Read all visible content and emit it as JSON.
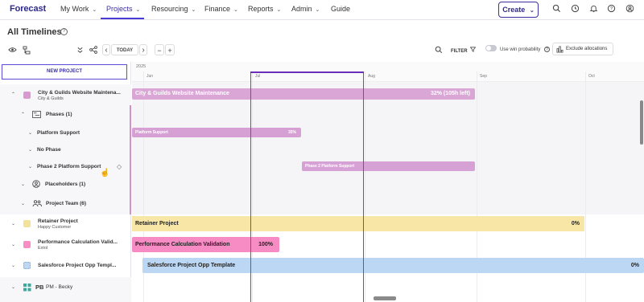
{
  "nav": {
    "logo": "Forecast",
    "items": [
      {
        "label": "My Work",
        "chev": "⌄"
      },
      {
        "label": "Projects",
        "chev": "⌄"
      },
      {
        "label": "Resourcing",
        "chev": "⌄"
      },
      {
        "label": "Finance",
        "chev": "⌄"
      },
      {
        "label": "Reports",
        "chev": "⌄"
      },
      {
        "label": "Admin",
        "chev": "⌄"
      },
      {
        "label": "Guide",
        "chev": ""
      }
    ],
    "create_label": "Create",
    "create_chev": "⌄",
    "icons": [
      "search-icon",
      "clock-icon",
      "bell-icon",
      "help-icon",
      "user-icon"
    ]
  },
  "page": {
    "title": "All Timelines",
    "help": "?"
  },
  "toolbar": {
    "today": "TODAY",
    "prev": "‹",
    "next": "›",
    "minus": "−",
    "plus": "+",
    "filter": "FILTER",
    "win_probability": "Use win probability",
    "exclude_allocations": "Exclude allocations"
  },
  "left": {
    "new_project": "NEW PROJECT",
    "rows": [
      {
        "title": "City & Guilds Website Maintena...",
        "sub": "City & Guilds",
        "color": "#d89ad0"
      },
      {
        "title": "Phases (1)"
      },
      {
        "title": "Platform Support"
      },
      {
        "title": "No Phase"
      },
      {
        "title": "Phase 2 Platform Support"
      },
      {
        "title": "Placeholders (1)"
      },
      {
        "title": "Project Team (6)"
      },
      {
        "title": "Retainer Project",
        "sub": "Happy Customer",
        "color": "#f4e29a"
      },
      {
        "title": "Performance Calculation Valid...",
        "sub": "Extol",
        "color": "#f78dc4"
      },
      {
        "title": "Salesforce Project Opp Templ...",
        "color": "#bcd8f2"
      },
      {
        "title": "PM - Becky",
        "prefix": "PB"
      }
    ]
  },
  "timeline": {
    "year": "2025",
    "months": [
      "Jun",
      "Jul",
      "Aug",
      "Sep",
      "Oct"
    ],
    "bars": [
      {
        "label": "City & Guilds Website Maintenance",
        "right": "32%  (105h left)",
        "color": "#d9a6d6"
      },
      {
        "label": "Platform Support",
        "right": "35%",
        "color": "#d7a0d5"
      },
      {
        "label": "Phase 2 Platform Support",
        "right": "",
        "color": "#d6a2d5"
      },
      {
        "label": "Retainer Project",
        "right": "0%",
        "color": "#f7e6a6"
      },
      {
        "label": "Performance Calculation Validation",
        "right": "100%",
        "color": "#f78bc4"
      },
      {
        "label": "Salesforce Project Opp Template",
        "right": "0%",
        "color": "#bcd7f3"
      }
    ]
  }
}
